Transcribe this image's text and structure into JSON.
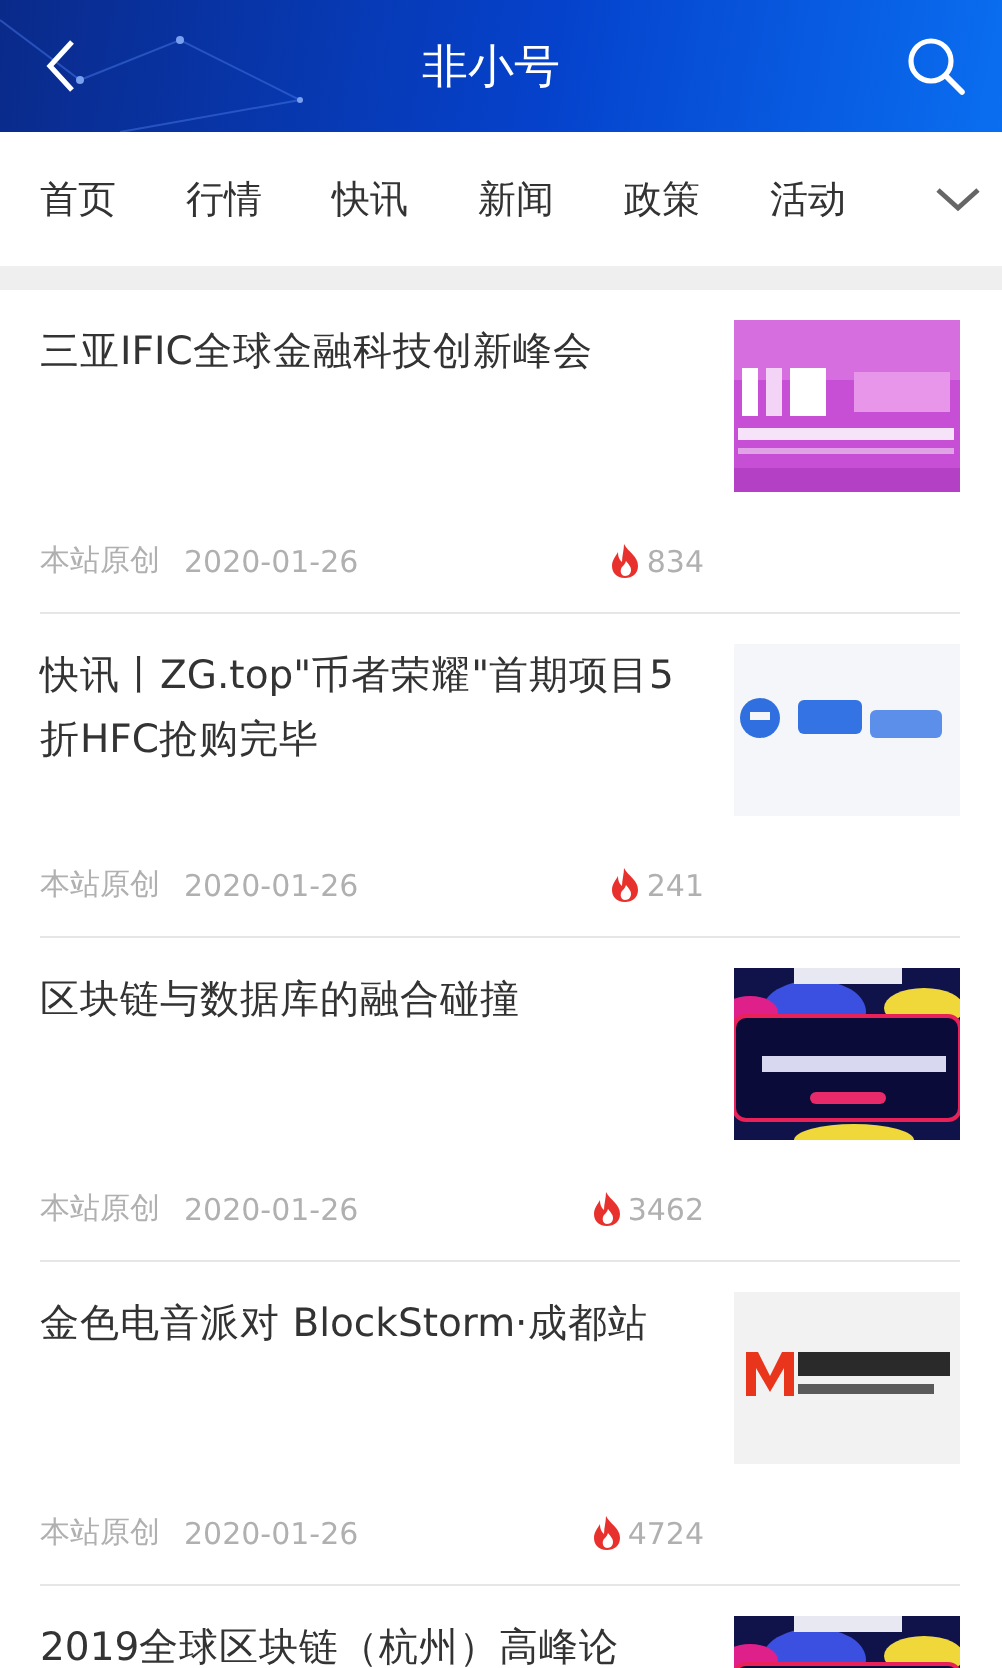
{
  "header": {
    "title": "非小号"
  },
  "tabs": [
    {
      "label": "首页"
    },
    {
      "label": "行情"
    },
    {
      "label": "快讯"
    },
    {
      "label": "新闻"
    },
    {
      "label": "政策"
    },
    {
      "label": "活动"
    }
  ],
  "articles": [
    {
      "title": "三亚IFIC全球金融科技创新峰会",
      "source": "本站原创",
      "date": "2020-01-26",
      "views": "834",
      "kind": "picture"
    },
    {
      "title": "快讯丨ZG.top\"币者荣耀\"首期项目5折HFC抢购完毕",
      "source": "本站原创",
      "date": "2020-01-26",
      "views": "241",
      "kind": "picture"
    },
    {
      "title": "区块链与数据库的融合碰撞",
      "source": "本站原创",
      "date": "2020-01-26",
      "views": "3462",
      "kind": "picture"
    },
    {
      "title": "金色电音派对 BlockStorm·成都站",
      "source": "本站原创",
      "date": "2020-01-26",
      "views": "4724",
      "kind": "picture"
    },
    {
      "title": "2019全球区块链（杭州）高峰论",
      "kind": "picture"
    }
  ]
}
